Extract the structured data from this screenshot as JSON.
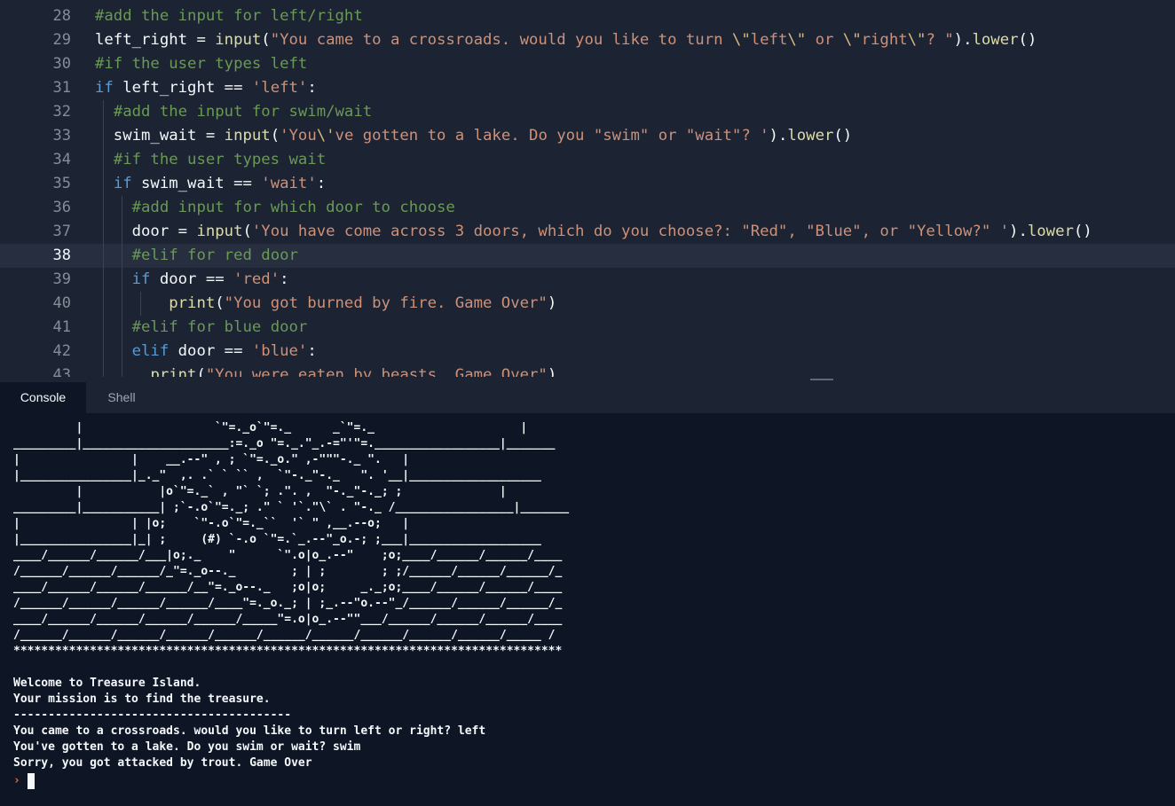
{
  "editor": {
    "lines": [
      {
        "num": "28",
        "tokens": [
          [
            "cm",
            "#add the input for left/right"
          ]
        ]
      },
      {
        "num": "29",
        "tokens": [
          [
            "",
            "left_right "
          ],
          [
            "",
            "= "
          ],
          [
            "fn",
            "input"
          ],
          [
            "",
            "("
          ],
          [
            "st",
            "\"You came to a crossroads. would you like to turn "
          ],
          [
            "esc",
            "\\\""
          ],
          [
            "st",
            "left"
          ],
          [
            "esc",
            "\\\""
          ],
          [
            "st",
            " or "
          ],
          [
            "esc",
            "\\\""
          ],
          [
            "st",
            "right"
          ],
          [
            "esc",
            "\\\""
          ],
          [
            "st",
            "? \""
          ],
          [
            "",
            ")."
          ],
          [
            "fn",
            "lower"
          ],
          [
            "",
            "()"
          ]
        ]
      },
      {
        "num": "30",
        "tokens": [
          [
            "cm",
            "#if the user types left"
          ]
        ]
      },
      {
        "num": "31",
        "tokens": [
          [
            "kw",
            "if"
          ],
          [
            "",
            " left_right == "
          ],
          [
            "st",
            "'left'"
          ],
          [
            "",
            ":"
          ]
        ]
      },
      {
        "num": "32",
        "tokens": [
          [
            "",
            "  "
          ],
          [
            "cm",
            "#add the input for swim/wait"
          ]
        ]
      },
      {
        "num": "33",
        "tokens": [
          [
            "",
            "  swim_wait = "
          ],
          [
            "fn",
            "input"
          ],
          [
            "",
            "("
          ],
          [
            "st",
            "'You"
          ],
          [
            "esc",
            "\\'"
          ],
          [
            "st",
            "ve gotten to a lake. Do you \"swim\" or \"wait\"? '"
          ],
          [
            "",
            ")."
          ],
          [
            "fn",
            "lower"
          ],
          [
            "",
            "()"
          ]
        ]
      },
      {
        "num": "34",
        "tokens": [
          [
            "",
            "  "
          ],
          [
            "cm",
            "#if the user types wait"
          ]
        ]
      },
      {
        "num": "35",
        "tokens": [
          [
            "",
            "  "
          ],
          [
            "kw",
            "if"
          ],
          [
            "",
            " swim_wait == "
          ],
          [
            "st",
            "'wait'"
          ],
          [
            "",
            ":"
          ]
        ]
      },
      {
        "num": "36",
        "tokens": [
          [
            "",
            "    "
          ],
          [
            "cm",
            "#add input for which door to choose"
          ]
        ]
      },
      {
        "num": "37",
        "tokens": [
          [
            "",
            "    door = "
          ],
          [
            "fn",
            "input"
          ],
          [
            "",
            "("
          ],
          [
            "st",
            "'You have come across 3 doors, which do you choose?: \"Red\", \"Blue\", or \"Yellow?\" '"
          ],
          [
            "",
            ")."
          ],
          [
            "fn",
            "lower"
          ],
          [
            "",
            "()"
          ]
        ]
      },
      {
        "num": "38",
        "tokens": [
          [
            "",
            "    "
          ],
          [
            "cm",
            "#elif for red door"
          ]
        ]
      },
      {
        "num": "39",
        "tokens": [
          [
            "",
            "    "
          ],
          [
            "kw",
            "if"
          ],
          [
            "",
            " door == "
          ],
          [
            "st",
            "'red'"
          ],
          [
            "",
            ":"
          ]
        ]
      },
      {
        "num": "40",
        "tokens": [
          [
            "",
            "        "
          ],
          [
            "fn",
            "print"
          ],
          [
            "",
            "("
          ],
          [
            "st",
            "\"You got burned by fire. Game Over\""
          ],
          [
            "",
            ")"
          ]
        ]
      },
      {
        "num": "41",
        "tokens": [
          [
            "",
            "    "
          ],
          [
            "cm",
            "#elif for blue door"
          ]
        ]
      },
      {
        "num": "42",
        "tokens": [
          [
            "",
            "    "
          ],
          [
            "kw",
            "elif"
          ],
          [
            "",
            " door == "
          ],
          [
            "st",
            "'blue'"
          ],
          [
            "",
            ":"
          ]
        ]
      },
      {
        "num": "43",
        "tokens": [
          [
            "",
            "      "
          ],
          [
            "fn",
            "print"
          ],
          [
            "",
            "("
          ],
          [
            "st",
            "\"You were eaten by beasts. Game Over\""
          ],
          [
            "",
            ")"
          ]
        ]
      }
    ]
  },
  "tabs": {
    "console": "Console",
    "shell": "Shell"
  },
  "console": {
    "ascii_art": "         |                   `\"=._o`\"=._      _`\"=._                     |\n_________|_____________________:=._o \"=._.\"_.-=\"'\"=.__________________|_______\n|                |    __.--\" , ; `\"=._o.\" ,-\"\"\"-._ \".   |\n|________________|_._\"  ,. .` ` `` ,  `\"-._\"-._   \". '__|___________________\n         |           |o`\"=._` , \"` `; .\". ,  \"-._\"-._; ;              |\n_________|___________| ;`-.o`\"=._; .\" ` '`.\"\\` . \"-._ /_________________|_______\n|                | |o;    `\"-.o`\"=._``  '` \" ,__.--o;   |\n|________________|_| ;     (#) `-.o `\"=.`_.--\"_o.-; ;___|___________________\n____/______/______/___|o;._    \"      `\".o|o_.--\"    ;o;____/______/______/____\n/______/______/______/_\"=._o--._        ; | ;        ; ;/______/______/______/_\n____/______/______/______/__\"=._o--._   ;o|o;     _._;o;____/______/______/____\n/______/______/______/______/____\"=._o._; | ;_.--\"o.--\"_/______/______/______/_\n____/______/______/______/______/_____\"=.o|o_.--\"\"___/______/______/______/____\n/______/______/______/______/______/______/______/______/______/______/_____ /\n*******************************************************************************",
    "blank": "",
    "welcome": "Welcome to Treasure Island.",
    "mission": "Your mission is to find the treasure.",
    "divider": "----------------------------------------",
    "q1": "You came to a crossroads. would you like to turn left or right? left",
    "q2": "You've gotten to a lake. Do you swim or wait? swim",
    "result": "Sorry, you got attacked by trout. Game Over",
    "prompt_symbol": "›"
  }
}
